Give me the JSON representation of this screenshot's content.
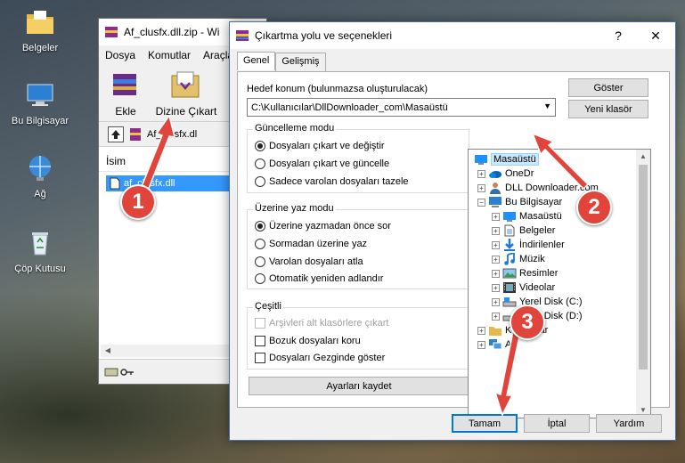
{
  "desktop": {
    "icons": [
      {
        "name": "folder-icon",
        "label": "Belgeler"
      },
      {
        "name": "computer-icon",
        "label": "Bu Bilgisayar"
      },
      {
        "name": "network-icon",
        "label": "Ağ"
      },
      {
        "name": "recycle-bin-icon",
        "label": "Çöp Kutusu"
      }
    ]
  },
  "winrar": {
    "title": "Af_clusfx.dll.zip - Wi",
    "menu": [
      "Dosya",
      "Komutlar",
      "Araçla"
    ],
    "tools": [
      {
        "label": "Ekle"
      },
      {
        "label": "Dizine Çıkart"
      }
    ],
    "path": "Af_clusfx.dl",
    "column": "İsim",
    "file": "af_clusfx.dll"
  },
  "dialog": {
    "title": "Çıkartma yolu ve seçenekleri",
    "tabs": [
      "Genel",
      "Gelişmiş"
    ],
    "dest_label": "Hedef konum (bulunmazsa oluşturulacak)",
    "dest_value": "C:\\Kullanıcılar\\DllDownloader_com\\Masaüstü",
    "show_btn": "Göster",
    "new_folder_btn": "Yeni klasör",
    "update_group": {
      "title": "Güncelleme modu",
      "options": [
        "Dosyaları çıkart ve değiştir",
        "Dosyaları çıkart ve güncelle",
        "Sadece varolan dosyaları tazele"
      ],
      "selected": 0
    },
    "overwrite_group": {
      "title": "Üzerine yaz modu",
      "options": [
        "Üzerine yazmadan önce sor",
        "Sormadan üzerine yaz",
        "Varolan dosyaları atla",
        "Otomatik yeniden adlandır"
      ],
      "selected": 0
    },
    "misc_group": {
      "title": "Çeşitli",
      "options": [
        "Arşivleri alt klasörlere çıkart",
        "Bozuk dosyaları koru",
        "Dosyaları Gezginde göster"
      ]
    },
    "save_btn": "Ayarları kaydet",
    "tree": [
      {
        "label": "Masaüstü",
        "icon": "desktop-icon",
        "selected": true
      },
      {
        "label": "OneDr",
        "icon": "onedrive-icon"
      },
      {
        "label": "DLL Downloader.com",
        "icon": "user-icon"
      },
      {
        "label": "Bu Bilgisayar",
        "icon": "computer-icon"
      },
      {
        "label": "Masaüstü",
        "icon": "desktop-icon"
      },
      {
        "label": "Belgeler",
        "icon": "documents-icon"
      },
      {
        "label": "İndirilenler",
        "icon": "downloads-icon"
      },
      {
        "label": "Müzik",
        "icon": "music-icon"
      },
      {
        "label": "Resimler",
        "icon": "pictures-icon"
      },
      {
        "label": "Videolar",
        "icon": "videos-icon"
      },
      {
        "label": "Yerel Disk (C:)",
        "icon": "drive-icon"
      },
      {
        "label": "Yerel Disk (D:)",
        "icon": "drive-icon"
      },
      {
        "label": "Kitaplıklar",
        "icon": "libraries-icon"
      },
      {
        "label": "Ağ",
        "icon": "network-icon"
      }
    ],
    "ok_btn": "Tamam",
    "cancel_btn": "İptal",
    "help_btn": "Yardım"
  },
  "steps": [
    "1",
    "2",
    "3"
  ],
  "colors": {
    "marker": "#e0443a",
    "selection": "#3399ff"
  }
}
